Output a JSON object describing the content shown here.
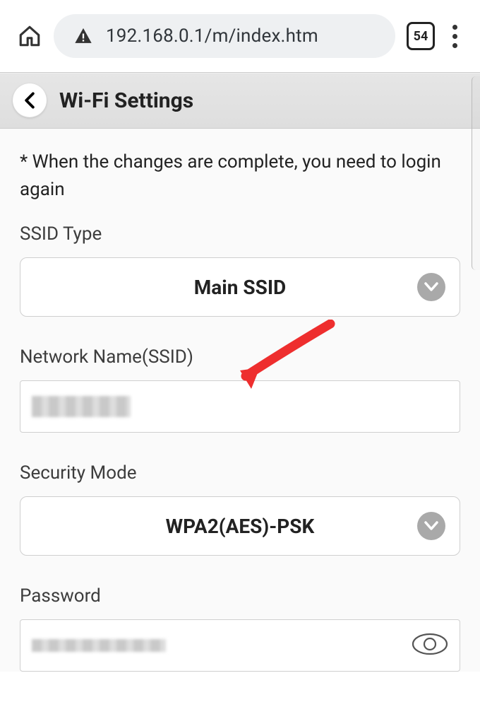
{
  "browser": {
    "url": "192.168.0.1/m/index.htm",
    "tab_count": "54"
  },
  "header": {
    "title": "Wi-Fi Settings"
  },
  "content": {
    "notice": "* When the changes are complete, you need to login again",
    "ssid_type": {
      "label": "SSID Type",
      "value": "Main SSID"
    },
    "network_name": {
      "label": "Network Name(SSID)",
      "value": ""
    },
    "security_mode": {
      "label": "Security Mode",
      "value": "WPA2(AES)-PSK"
    },
    "password": {
      "label": "Password",
      "value": ""
    }
  }
}
